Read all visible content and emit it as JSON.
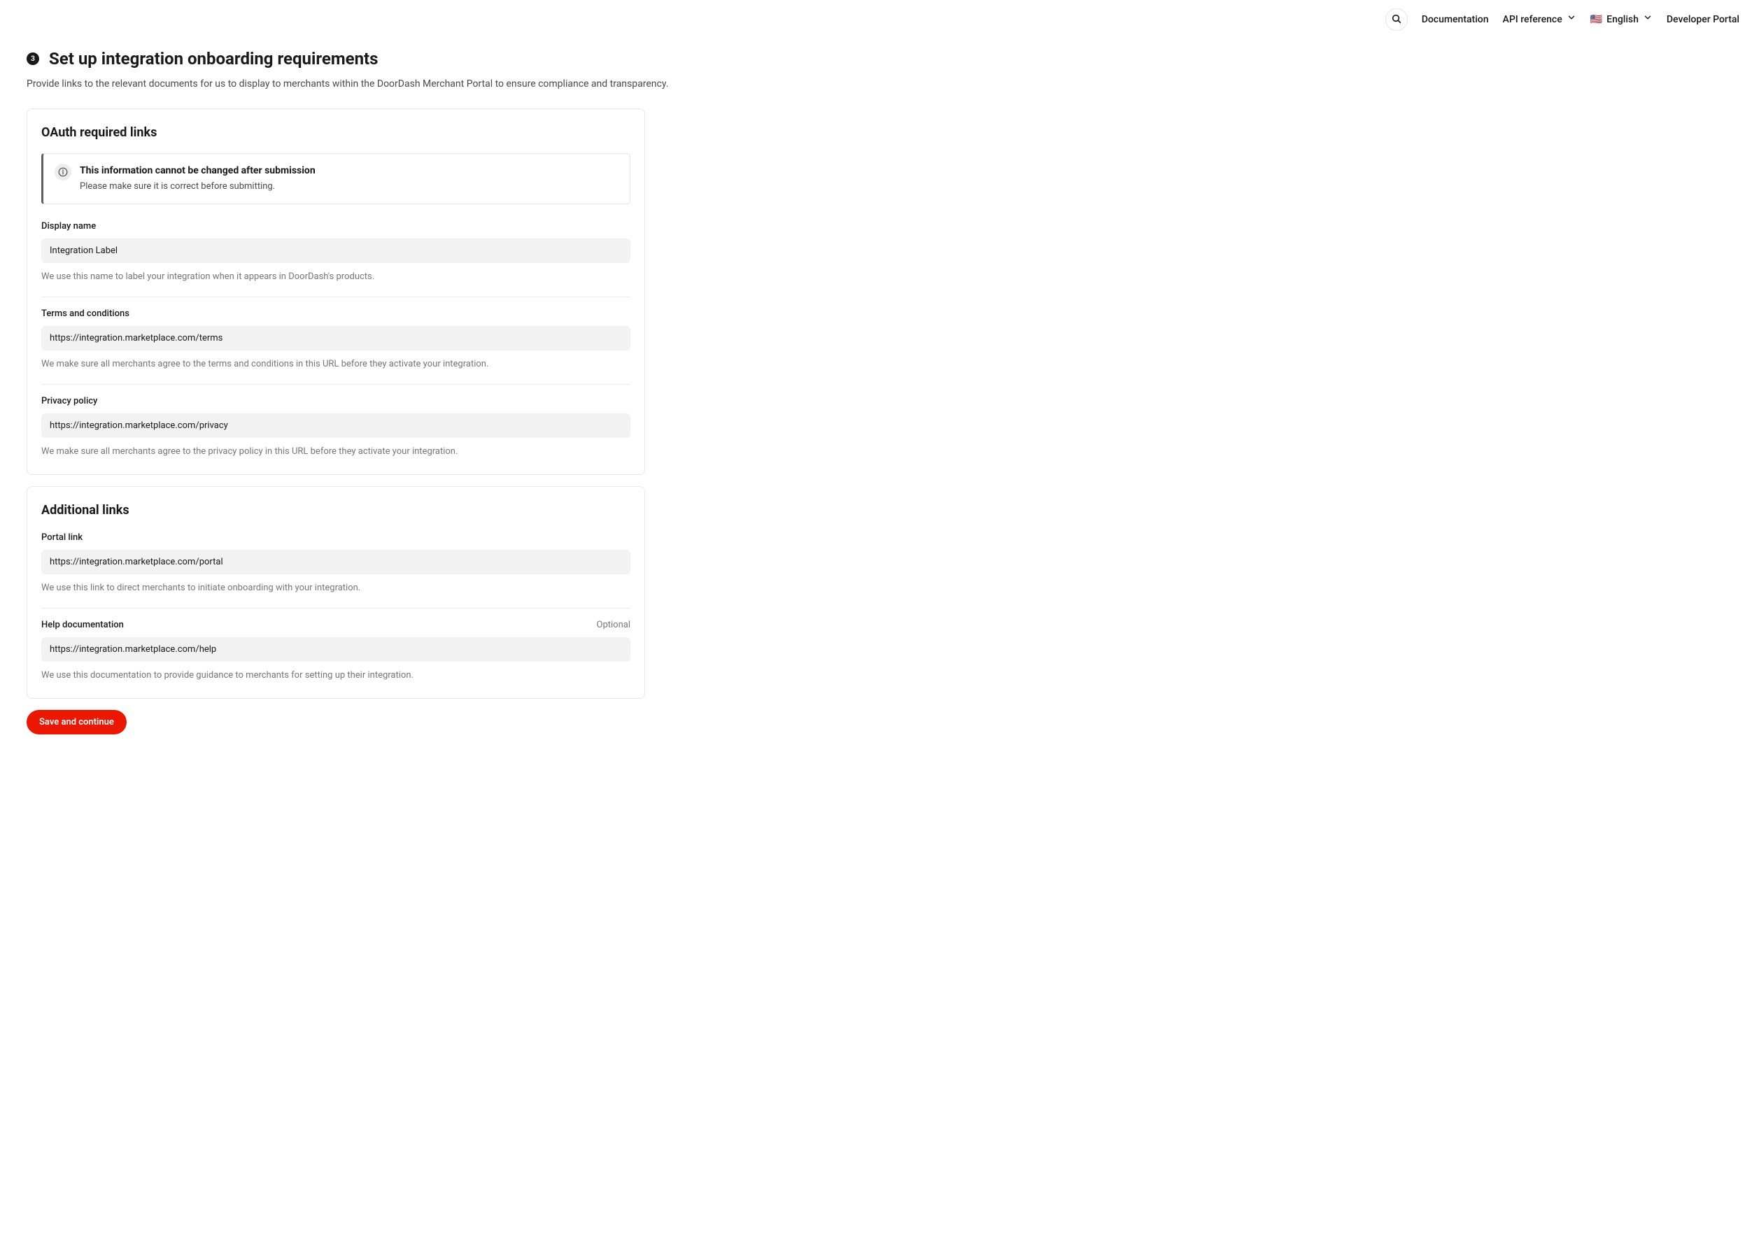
{
  "topbar": {
    "documentation": "Documentation",
    "api_reference": "API reference",
    "language": "English",
    "developer_portal": "Developer Portal"
  },
  "page": {
    "step_number": "3",
    "title": "Set up integration onboarding requirements",
    "subtitle": "Provide links to the relevant documents for us to display to merchants within the DoorDash Merchant Portal to ensure compliance and transparency."
  },
  "oauth_card": {
    "title": "OAuth required links",
    "callout": {
      "title": "This information cannot be changed after submission",
      "body": "Please make sure it is correct before submitting."
    },
    "fields": {
      "display_name": {
        "label": "Display name",
        "value": "Integration Label",
        "help": "We use this name to label your integration when it appears in DoorDash's products."
      },
      "terms": {
        "label": "Terms and conditions",
        "value": "https://integration.marketplace.com/terms",
        "help": "We make sure all merchants agree to the terms and conditions in this URL before they activate your integration."
      },
      "privacy": {
        "label": "Privacy policy",
        "value": "https://integration.marketplace.com/privacy",
        "help": "We make sure all merchants agree to the privacy policy in this URL before they activate your integration."
      }
    }
  },
  "additional_card": {
    "title": "Additional links",
    "fields": {
      "portal": {
        "label": "Portal link",
        "value": "https://integration.marketplace.com/portal",
        "help": "We use this link to direct merchants to initiate onboarding with your integration."
      },
      "help_doc": {
        "label": "Help documentation",
        "optional": "Optional",
        "value": "https://integration.marketplace.com/help",
        "help": "We use this documentation to provide guidance to merchants for setting up their integration."
      }
    }
  },
  "actions": {
    "save": "Save and continue"
  }
}
